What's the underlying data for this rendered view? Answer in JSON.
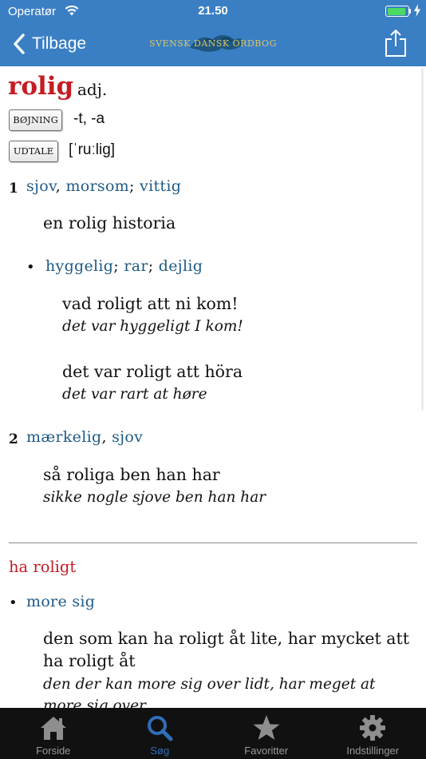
{
  "status_bar": {
    "carrier": "Operatør",
    "time": "21.50"
  },
  "nav": {
    "back_label": "Tilbage",
    "logo_text": "SVENSK DANSK ORDBOG"
  },
  "entry": {
    "headword": "rolig",
    "pos": "adj.",
    "tags": [
      {
        "label": "BØJNING",
        "value": "-t, -a"
      },
      {
        "label": "UDTALE",
        "value": "[ˈruːlig]"
      }
    ],
    "senses": [
      {
        "number": "1",
        "synonyms": [
          {
            "word": "sjov",
            "sep": ", "
          },
          {
            "word": "morsom",
            "sep": "; "
          },
          {
            "word": "vittig",
            "sep": ""
          }
        ],
        "examples": [
          {
            "sv": "en rolig historia",
            "da": ""
          }
        ],
        "sub": {
          "bullet": "•",
          "synonyms": [
            {
              "word": "hyggelig",
              "sep": "; "
            },
            {
              "word": "rar",
              "sep": "; "
            },
            {
              "word": "dejlig",
              "sep": ""
            }
          ],
          "examples": [
            {
              "sv": "vad roligt att ni kom!",
              "da": "det var hyggeligt I kom!"
            },
            {
              "sv": "det var roligt att höra",
              "da": "det var rart at høre"
            }
          ]
        }
      },
      {
        "number": "2",
        "synonyms": [
          {
            "word": "mærkelig",
            "sep": ", "
          },
          {
            "word": "sjov",
            "sep": ""
          }
        ],
        "examples": [
          {
            "sv": "så roliga ben han har",
            "da": "sikke nogle sjove ben han har"
          }
        ]
      }
    ],
    "phrase": {
      "text": "ha roligt",
      "bullet": "•",
      "synonyms": [
        {
          "word": "more sig",
          "sep": ""
        }
      ],
      "example": {
        "sv_line1": "den som kan ha roligt åt lite, har mycket att",
        "sv_line2": "ha roligt åt",
        "da_line1": "den der kan more sig over lidt, har meget at",
        "da_line2": "more sig over"
      }
    }
  },
  "tabs": [
    {
      "label": "Forside",
      "icon": "house-icon",
      "active": false
    },
    {
      "label": "Søg",
      "icon": "search-icon",
      "active": true
    },
    {
      "label": "Favoritter",
      "icon": "star-icon",
      "active": false
    },
    {
      "label": "Indstillinger",
      "icon": "gear-icon",
      "active": false
    }
  ],
  "colors": {
    "nav_blue": "#3a7fc4",
    "headword_red": "#c41d23",
    "synonym_blue": "#1e5a86",
    "tab_active": "#2f6eb8",
    "tab_inactive": "#9a9a9a",
    "tabbar_bg": "#111111"
  }
}
